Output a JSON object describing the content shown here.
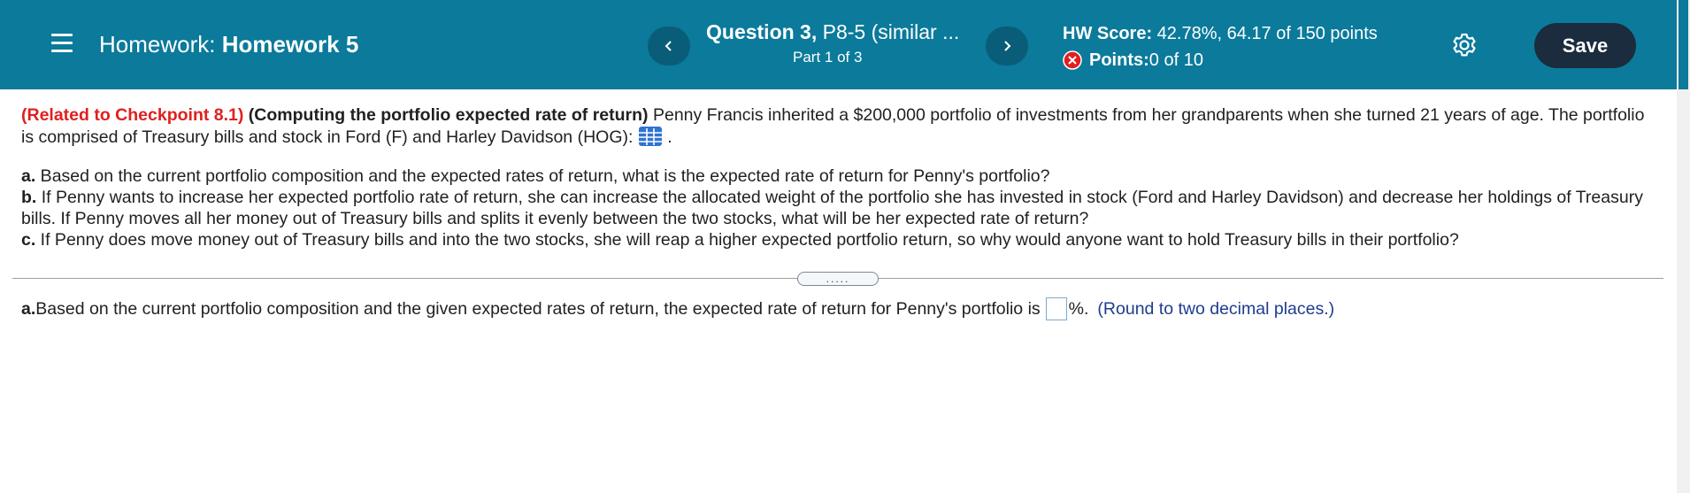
{
  "header": {
    "homework_label": "Homework:",
    "homework_name": "Homework 5",
    "question_bold": "Question 3,",
    "question_rest": " P8-5 (similar ...",
    "part": "Part 1 of 3",
    "score_label": "HW Score:",
    "score_value": " 42.78%, 64.17 of 150 points",
    "points_label": "Points:",
    "points_value": " 0 of 10",
    "save_label": "Save",
    "prev_icon": "chevron-left-icon",
    "next_icon": "chevron-right-icon",
    "menu_icon": "hamburger-menu-icon",
    "settings_icon": "gear-icon",
    "status_icon": "x-circle-icon",
    "colors": {
      "bar": "#0b7a9b",
      "nav_button": "#0a5d78",
      "save_button": "#1a2c3d",
      "incorrect": "#e0201f"
    }
  },
  "question": {
    "related": "(Related to Checkpoint 8.1)",
    "topic": "(Computing the portfolio expected rate of return)",
    "intro": " Penny Francis inherited a $200,000 portfolio of investments from her grandparents when she turned 21 years of age. The portfolio is comprised of Treasury bills and stock in Ford (F) and Harley Davidson (HOG): ",
    "intro_end": ".",
    "a_label": "a.",
    "a_text": " Based on the current portfolio composition and the expected rates of return, what is the expected rate of return for Penny's portfolio?",
    "b_label": "b.",
    "b_text": " If Penny wants to increase her expected portfolio rate of return, she can increase the allocated weight of the portfolio she has invested in stock (Ford and Harley Davidson) and decrease her holdings of Treasury bills. If Penny moves all her money out of Treasury bills and splits it evenly between the two stocks, what will be her expected rate of return?",
    "c_label": "c.",
    "c_text": " If Penny does move money out of Treasury bills and into the two stocks, she will reap a higher expected portfolio return, so why would anyone want to hold Treasury bills in their portfolio?",
    "data_table_icon": "data-table-icon"
  },
  "divider": {
    "expand_label": "....."
  },
  "answer": {
    "label": "a.",
    "text": " Based on the current portfolio composition and the given expected rates of return, the expected rate of return for Penny's portfolio is",
    "value": "",
    "unit": "%.",
    "hint": "(Round to two decimal places.)"
  }
}
